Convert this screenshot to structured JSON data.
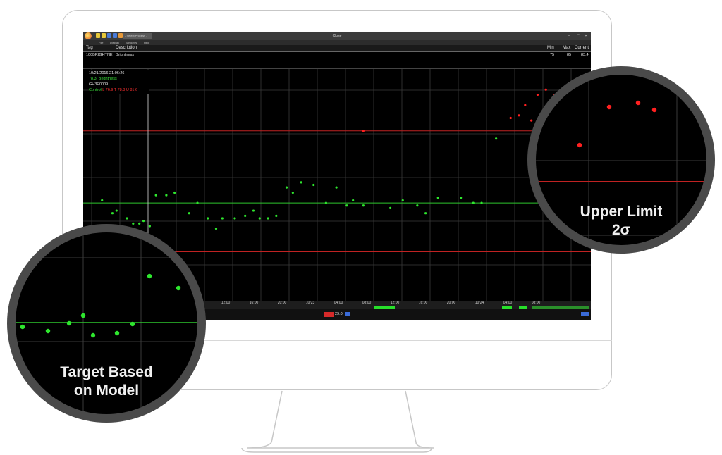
{
  "window": {
    "title": "Close",
    "process_select": "- Select Process -",
    "min": "‒",
    "max": "▢",
    "close": "✕"
  },
  "menu": [
    "File",
    "Display",
    "Windows",
    "Help"
  ],
  "table": {
    "headers": {
      "tag": "Tag",
      "description": "Description",
      "min": "Min",
      "max": "Max",
      "current": "Current"
    },
    "row": {
      "tag": "100BRIGHTNE",
      "description": "Brightness",
      "min": "75",
      "max": "85",
      "current": "83.4"
    }
  },
  "info": {
    "timestamp": "10/21/2016 21:06:26",
    "value": "78.3",
    "name": "Brightness",
    "id": "GH3E0009",
    "control_label": "Control",
    "lower": "L 76.9",
    "target": "T 78.8",
    "upper": "U 81.6"
  },
  "chart_data": {
    "type": "scatter",
    "series": [
      {
        "name": "Brightness",
        "x": [
          0.5,
          1.0,
          1.2,
          1.7,
          2.0,
          2.3,
          2.5,
          2.8,
          3.1,
          3.6,
          4.0,
          4.7,
          5.1,
          5.6,
          6.0,
          6.3,
          6.9,
          7.4,
          7.8,
          8.1,
          8.5,
          8.9,
          9.4,
          9.7,
          10.1,
          10.7,
          11.3,
          11.8,
          12.3,
          12.6,
          13.1,
          14.4,
          15.0,
          15.7,
          16.1,
          16.7,
          17.8,
          18.4,
          18.8,
          19.5,
          20.2,
          20.6,
          21.2,
          21.6,
          22.3,
          22.8
        ],
        "y": [
          78.9,
          78.4,
          78.5,
          78.2,
          78.0,
          78.0,
          78.1,
          77.9,
          79.1,
          79.1,
          79.2,
          78.4,
          78.8,
          78.2,
          77.8,
          78.2,
          78.2,
          78.3,
          78.5,
          78.2,
          78.2,
          78.3,
          79.4,
          79.2,
          79.6,
          79.5,
          78.8,
          79.4,
          78.7,
          78.9,
          78.7,
          78.6,
          78.9,
          78.7,
          78.4,
          79.0,
          79.0,
          78.8,
          78.8,
          81.3,
          82.1,
          82.2,
          82.0,
          78.8,
          79.1,
          78.8
        ]
      }
    ],
    "outliers": {
      "x": [
        13.1,
        20.9,
        21.5,
        21.9,
        22.3
      ],
      "y": [
        81.6,
        82.6,
        83.0,
        83.2,
        83.0
      ]
    },
    "control_limits": {
      "lower": 76.9,
      "target": 78.8,
      "upper": 81.6
    },
    "ticks": [
      "08:00",
      "12:00",
      "16:00",
      "20:00",
      "10/23",
      "04:00",
      "08:00",
      "12:00",
      "16:00",
      "20:00",
      "10/24",
      "04:00",
      "08:00"
    ],
    "grid": true
  },
  "status": {
    "value": "29.0"
  },
  "callouts": {
    "target": {
      "line1": "Target Based",
      "line2": "on Model"
    },
    "upper": {
      "line1": "Upper Limit",
      "line2": "2σ"
    }
  },
  "colors": {
    "in_control": "#2ee62e",
    "out_of_control": "#ff2020",
    "target_line": "#2ec62e",
    "limit_line": "#c02222"
  }
}
